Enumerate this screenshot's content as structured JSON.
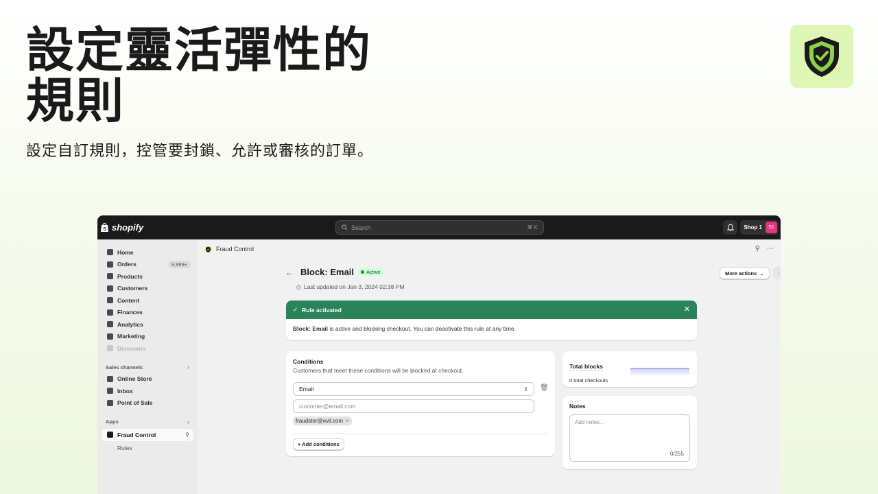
{
  "hero": {
    "title_line1": "設定靈活彈性的",
    "title_line2": "規則",
    "subtitle": "設定自訂規則，控管要封鎖、允許或審核的訂單。",
    "logo_icon": "shield-check-icon",
    "logo_bg": "#dff7b6"
  },
  "topbar": {
    "brand": "shopify",
    "search_placeholder": "Search",
    "search_shortcut": "⌘ K",
    "shop_name": "Shop 1",
    "avatar_initials": "S1",
    "avatar_color": "#e6357c"
  },
  "sidebar": {
    "items": [
      {
        "label": "Home",
        "icon": "home-icon"
      },
      {
        "label": "Orders",
        "icon": "orders-icon",
        "badge": "9,999+"
      },
      {
        "label": "Products",
        "icon": "tag-icon"
      },
      {
        "label": "Customers",
        "icon": "person-icon"
      },
      {
        "label": "Content",
        "icon": "content-icon"
      },
      {
        "label": "Finances",
        "icon": "bank-icon"
      },
      {
        "label": "Analytics",
        "icon": "chart-icon"
      },
      {
        "label": "Marketing",
        "icon": "target-icon"
      },
      {
        "label": "Discounts",
        "icon": "discount-icon"
      }
    ],
    "sales_channels_label": "Sales channels",
    "channels": [
      {
        "label": "Online Store",
        "icon": "store-icon"
      },
      {
        "label": "Inbox",
        "icon": "inbox-icon"
      },
      {
        "label": "Point of Sale",
        "icon": "pos-icon"
      }
    ],
    "apps_label": "Apps",
    "active_app": "Fraud Control",
    "sub_item": "Rules"
  },
  "page": {
    "breadcrumb_app": "Fraud Control",
    "title": "Block: Email",
    "status": "Active",
    "last_updated": "Last updated on Jan 3, 2024 02:38 PM",
    "more_actions": "More actions"
  },
  "banner": {
    "title": "Rule activated",
    "body_bold": "Block: Email",
    "body_rest": " is active and blocking checkout. You can deactivate this rule at any time.",
    "color": "#29845a"
  },
  "conditions": {
    "title": "Conditions",
    "description": "Customers that meet these conditions will be blocked at checkout.",
    "field_value": "Email",
    "input_placeholder": "customer@email.com",
    "tags": [
      "fraudster@evil.com"
    ],
    "add_label": "+ Add conditions"
  },
  "total_blocks": {
    "title": "Total blocks",
    "subtitle": "0 total checkouts"
  },
  "notes": {
    "title": "Notes",
    "placeholder": "Add notes...",
    "counter": "0/255"
  }
}
